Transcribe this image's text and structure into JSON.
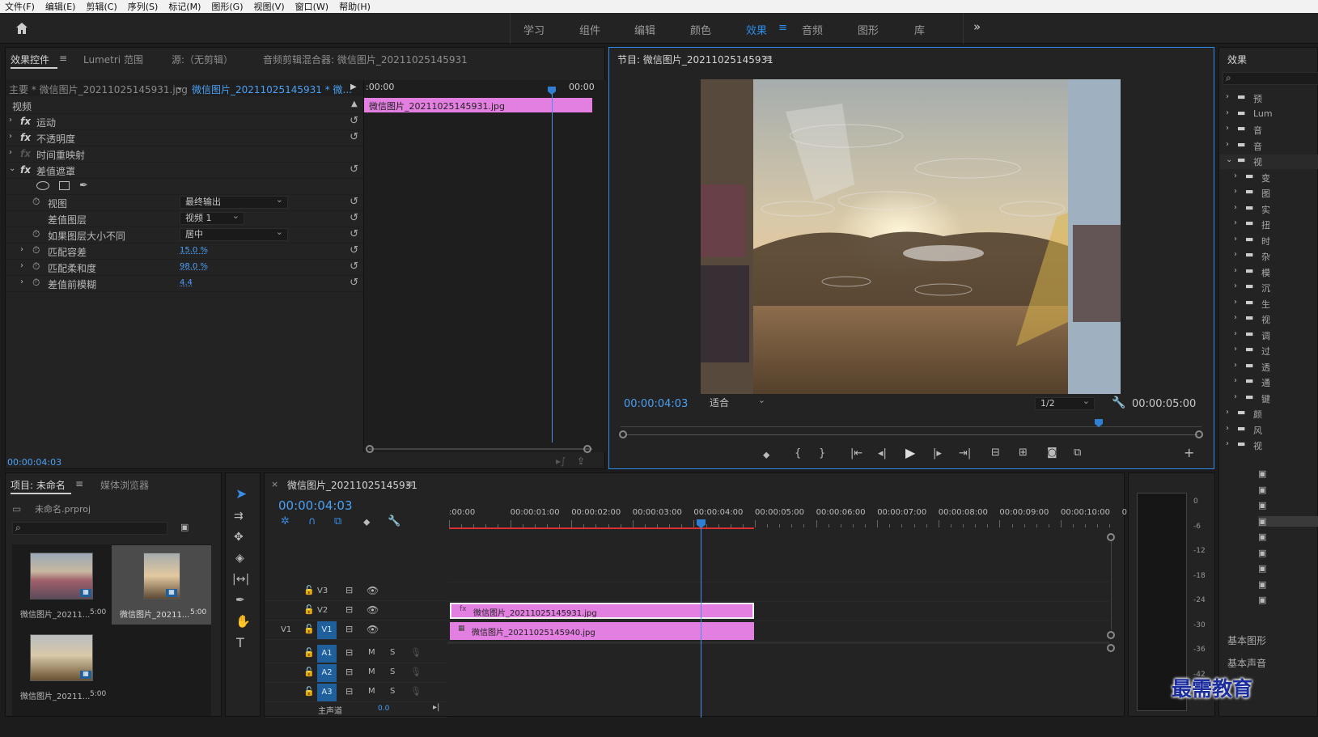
{
  "menu": [
    "文件(F)",
    "编辑(E)",
    "剪辑(C)",
    "序列(S)",
    "标记(M)",
    "图形(G)",
    "视图(V)",
    "窗口(W)",
    "帮助(H)"
  ],
  "workspaces": {
    "tabs": [
      "学习",
      "组件",
      "编辑",
      "颜色",
      "效果",
      "音频",
      "图形",
      "库"
    ],
    "active": "效果",
    "more": "»"
  },
  "effect_controls": {
    "tabs": [
      "效果控件",
      "Lumetri 范围",
      "源:（无剪辑）",
      "音频剪辑混合器: 微信图片_20211025145931"
    ],
    "master": "主要 * 微信图片_20211025145931.jpg",
    "clip": "微信图片_20211025145931 * 微...",
    "time_start": ":00:00",
    "time_end": "00:00",
    "clip_bar": "微信图片_20211025145931.jpg",
    "section": "视频",
    "effects": [
      "运动",
      "不透明度",
      "时间重映射",
      "差值遮罩"
    ],
    "params": [
      {
        "label": "视图",
        "value": "最终输出",
        "type": "dropdown"
      },
      {
        "label": "差值图层",
        "value": "视频 1",
        "type": "dropdown"
      },
      {
        "label": "如果图层大小不同",
        "value": "居中",
        "type": "dropdown"
      },
      {
        "label": "匹配容差",
        "value": "15.0 %",
        "type": "number"
      },
      {
        "label": "匹配柔和度",
        "value": "98.0 %",
        "type": "number"
      },
      {
        "label": "差值前模糊",
        "value": "4.4",
        "type": "number"
      }
    ],
    "current_time": "00:00:04:03"
  },
  "program": {
    "title": "节目: 微信图片_20211025145931",
    "timecode": "00:00:04:03",
    "fit": "适合",
    "resolution": "1/2",
    "duration": "00:00:05:00"
  },
  "effects_panel": {
    "title": "效果",
    "items": [
      "预",
      "Lum",
      "音",
      "音",
      "视",
      "变",
      "图",
      "实",
      "扭",
      "时",
      "杂",
      "模",
      "沉",
      "生",
      "视",
      "调",
      "过",
      "透",
      "通",
      "键",
      "颜",
      "风",
      "视"
    ],
    "extra": [
      "基本图形",
      "基本声音"
    ]
  },
  "project": {
    "tabs": [
      "项目: 未命名",
      "媒体浏览器"
    ],
    "file": "未命名.prproj",
    "items": [
      {
        "name": "微信图片_20211...",
        "dur": "5:00"
      },
      {
        "name": "微信图片_20211...",
        "dur": "5:00"
      },
      {
        "name": "微信图片_20211...",
        "dur": "5:00"
      }
    ]
  },
  "timeline": {
    "title": "微信图片_20211025145931",
    "timecode": "00:00:04:03",
    "ruler": [
      ":00:00",
      "00:00:01:00",
      "00:00:02:00",
      "00:00:03:00",
      "00:00:04:00",
      "00:00:05:00",
      "00:00:06:00",
      "00:00:07:00",
      "00:00:08:00",
      "00:00:09:00",
      "00:00:10:00",
      "0"
    ],
    "tracks": {
      "video": [
        "V3",
        "V2",
        "V1"
      ],
      "audio": [
        "A1",
        "A2",
        "A3"
      ],
      "src": "V1",
      "mix": "主声道",
      "mix_val": "0.0"
    },
    "clips": [
      {
        "track": "V2",
        "name": "微信图片_20211025145931.jpg"
      },
      {
        "track": "V1",
        "name": "微信图片_20211025145940.jpg"
      }
    ]
  },
  "meter": {
    "scale": [
      "0",
      "-6",
      "-12",
      "-18",
      "-24",
      "-30",
      "-36",
      "-42"
    ]
  },
  "watermark": "最需教育"
}
